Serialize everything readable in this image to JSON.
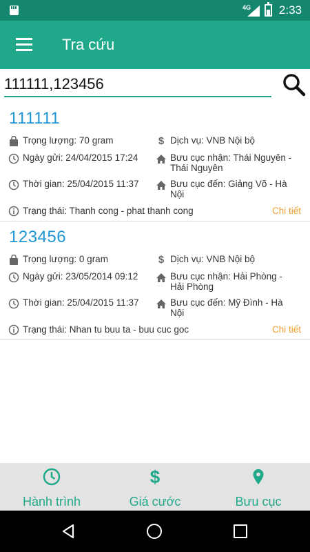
{
  "status_bar": {
    "network": "4G",
    "time": "2:33"
  },
  "toolbar": {
    "title": "Tra cứu"
  },
  "search": {
    "value": "111111,123456"
  },
  "results": [
    {
      "code": "111111",
      "weight": "Trọng lượng: 70 gram",
      "service": "Dịch vụ: VNB Nội bộ",
      "sent_date": "Ngày gửi: 24/04/2015 17:24",
      "receiving_office": "Bưu cục nhận: Thái Nguyên - Thái Nguyên",
      "time": "Thời gian: 25/04/2015 11:37",
      "destination_office": "Bưu cục đến: Giảng Võ - Hà Nội",
      "status": "Trạng thái: Thanh cong - phat thanh cong",
      "detail_link": "Chi tiết"
    },
    {
      "code": "123456",
      "weight": "Trọng lượng: 0 gram",
      "service": "Dịch vụ: VNB Nội bộ",
      "sent_date": "Ngày gửi: 23/05/2014 09:12",
      "receiving_office": "Bưu cục nhận: Hải Phòng - Hải Phòng",
      "time": "Thời gian: 25/04/2015 11:37",
      "destination_office": "Bưu cục đến: Mỹ Đình - Hà Nội",
      "status": "Trạng thái: Nhan tu buu ta - buu cuc goc",
      "detail_link": "Chi tiết"
    }
  ],
  "bottom_nav": [
    {
      "label": "Hành trình",
      "icon": "clock-icon"
    },
    {
      "label": "Giá cước",
      "icon": "dollar-icon"
    },
    {
      "label": "Bưu cục",
      "icon": "location-pin-icon"
    }
  ],
  "colors": {
    "status_bar": "#16876f",
    "toolbar": "#1fa98a",
    "code": "#2196d4",
    "detail_link": "#f0a030",
    "nav_accent": "#1fa98a"
  }
}
